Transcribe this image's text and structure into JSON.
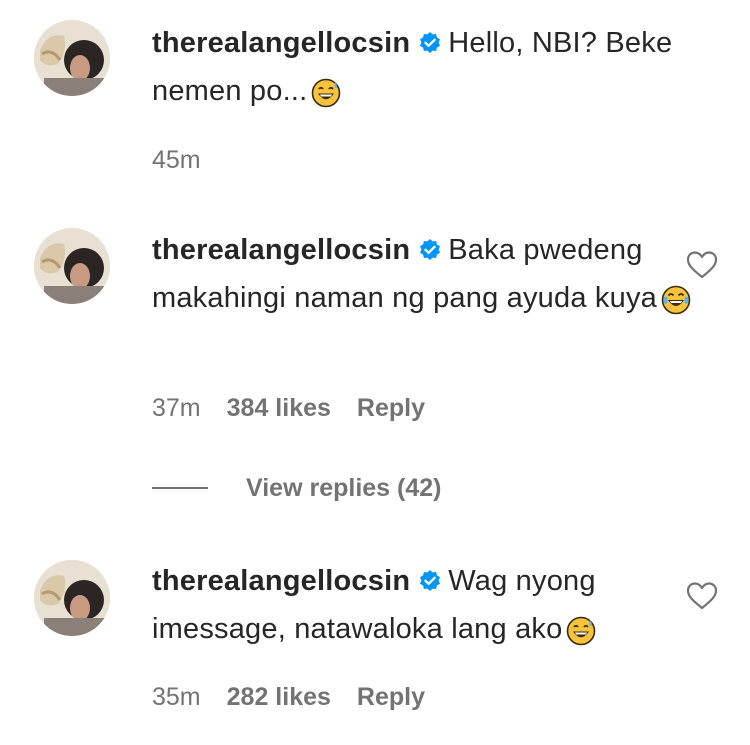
{
  "comments": [
    {
      "username": "therealangellocsin",
      "text": "Hello, NBI? Beke nemen po...",
      "emoji": "grinning-face-with-sweat",
      "time": "45m",
      "likes": "",
      "reply_label": ""
    },
    {
      "username": "therealangellocsin",
      "text": "Baka pwedeng makahingi naman ng pang ayuda kuya",
      "emoji": "face-with-tears-of-joy",
      "time": "37m",
      "likes": "384 likes",
      "reply_label": "Reply"
    },
    {
      "username": "therealangellocsin",
      "text": "Wag nyong imessage, natawaloka lang ako",
      "emoji": "grinning-face-with-sweat",
      "time": "35m",
      "likes": "282 likes",
      "reply_label": "Reply"
    }
  ],
  "view_replies_label": "View replies (42)",
  "icons": {
    "verified": "verified-badge-icon",
    "like": "heart-outline-icon"
  },
  "colors": {
    "verified_blue": "#0095f6",
    "meta_gray": "#737373",
    "text": "#262626"
  }
}
